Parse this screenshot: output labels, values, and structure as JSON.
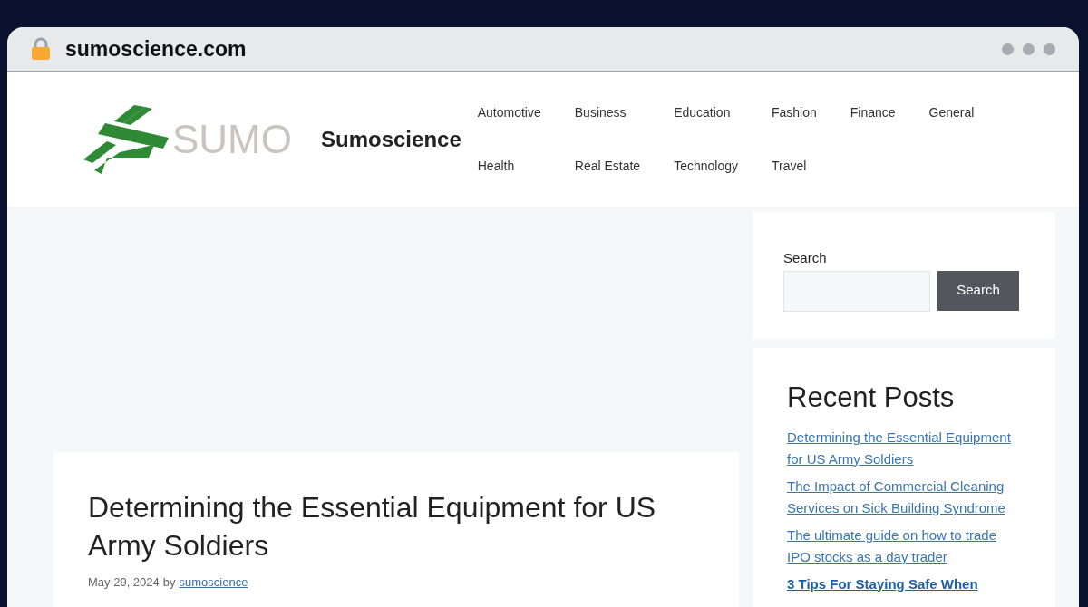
{
  "browser": {
    "address": "sumoscience.com"
  },
  "site": {
    "logo_text": "SUMO",
    "title": "Sumoscience"
  },
  "nav": [
    {
      "label": "Automotive"
    },
    {
      "label": "Business"
    },
    {
      "label": "Education"
    },
    {
      "label": "Fashion"
    },
    {
      "label": "Finance"
    },
    {
      "label": "General"
    },
    {
      "label": "Health"
    },
    {
      "label": "Real Estate"
    },
    {
      "label": "Technology"
    },
    {
      "label": "Travel"
    }
  ],
  "article": {
    "title": "Determining the Essential Equipment for US Army Soldiers",
    "date": "May 29, 2024",
    "by": "by",
    "author": "sumoscience"
  },
  "search": {
    "label": "Search",
    "button": "Search"
  },
  "recent_posts": {
    "heading": "Recent Posts",
    "items": [
      {
        "title": "Determining the Essential Equipment for US Army Soldiers ",
        "bold": false
      },
      {
        "title": "The Impact of Commercial Cleaning Services on Sick Building Syndrome",
        "bold": false
      },
      {
        "title": "The ultimate guide on how to trade IPO stocks as a day trader",
        "bold": false
      },
      {
        "title": "3 Tips For Staying Safe When",
        "bold": true
      }
    ]
  }
}
